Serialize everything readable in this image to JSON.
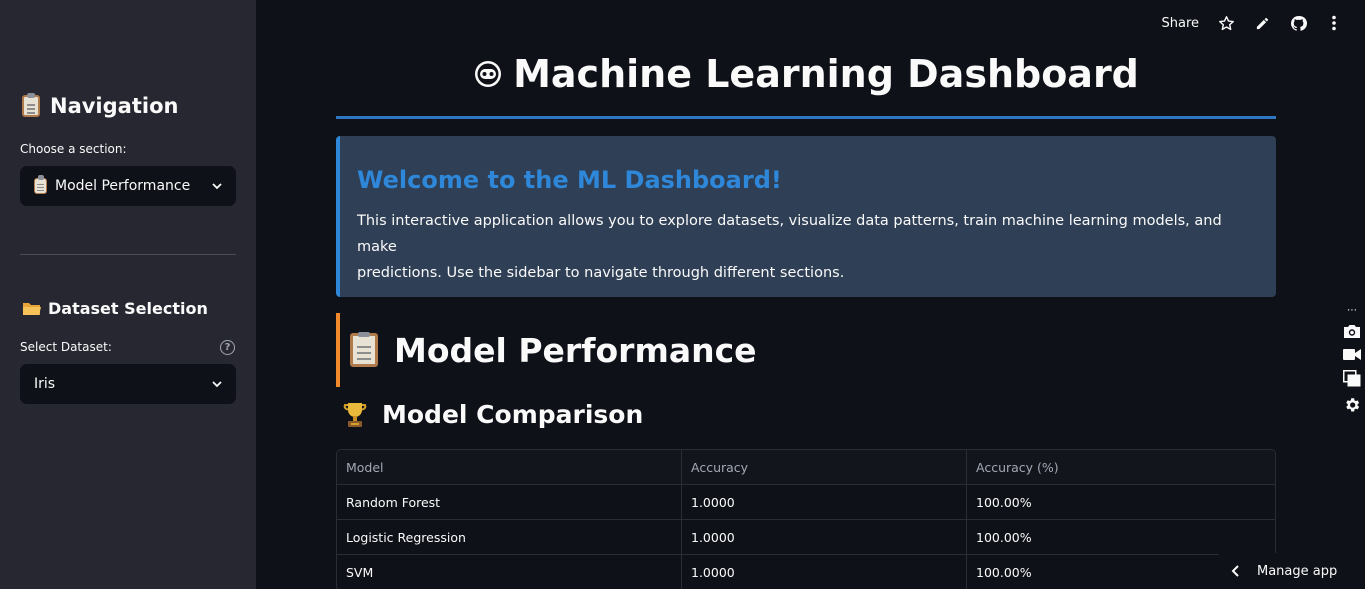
{
  "sidebar": {
    "nav_title": "Navigation",
    "section_label": "Choose a section:",
    "section_select": "Model Performance",
    "dataset_title": "Dataset Selection",
    "dataset_label": "Select Dataset:",
    "dataset_select": "Iris",
    "help_glyph": "?"
  },
  "toolbar": {
    "share_label": "Share",
    "icons": [
      "star-icon",
      "pencil-icon",
      "github-icon",
      "more-vert-icon"
    ]
  },
  "main": {
    "title": "Machine Learning Dashboard",
    "welcome": {
      "heading": "Welcome to the ML Dashboard!",
      "body_line1": "This interactive application allows you to explore datasets, visualize data patterns, train machine learning models, and make",
      "body_line2": "predictions. Use the sidebar to navigate through different sections."
    },
    "section_title": "Model Performance",
    "subsection_title": "Model Comparison",
    "table": {
      "headers": [
        "Model",
        "Accuracy",
        "Accuracy (%)"
      ],
      "rows": [
        [
          "Random Forest",
          "1.0000",
          "100.00%"
        ],
        [
          "Logistic Regression",
          "1.0000",
          "100.00%"
        ],
        [
          "SVM",
          "1.0000",
          "100.00%"
        ]
      ]
    }
  },
  "footer": {
    "manage_app": "Manage app"
  },
  "colors": {
    "accent_blue": "#2e87d8",
    "accent_orange": "#f18a2a",
    "sidebar_bg": "#262730",
    "main_bg": "#0e1117"
  }
}
